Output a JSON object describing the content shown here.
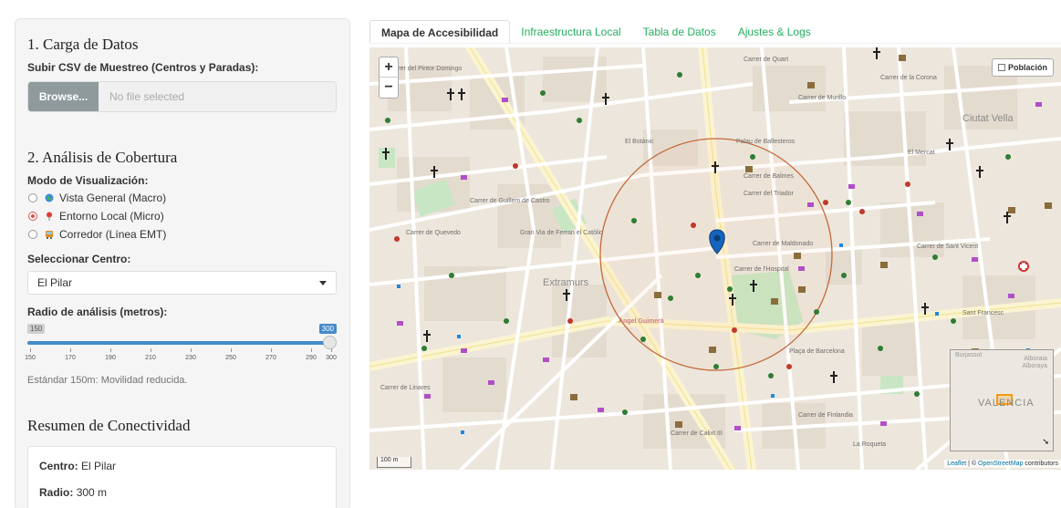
{
  "sidebar": {
    "section1_title": "1. Carga de Datos",
    "upload_label": "Subir CSV de Muestreo (Centros y Paradas):",
    "browse_label": "Browse...",
    "file_placeholder": "No file selected",
    "section2_title": "2. Análisis de Cobertura",
    "mode_label": "Modo de Visualización:",
    "modes": [
      {
        "label": "Vista General (Macro)",
        "icon": "globe-icon",
        "selected": false
      },
      {
        "label": "Entorno Local (Micro)",
        "icon": "pin-icon",
        "selected": true
      },
      {
        "label": "Corredor (Línea EMT)",
        "icon": "bus-icon",
        "selected": false
      }
    ],
    "center_label": "Seleccionar Centro:",
    "center_value": "El Pilar",
    "radius_label": "Radio de análisis (metros):",
    "slider": {
      "min": 150,
      "max": 300,
      "value": 300,
      "min_label": "150",
      "max_label": "300",
      "ticks": [
        "150",
        "170",
        "190",
        "210",
        "230",
        "250",
        "270",
        "290",
        "300"
      ]
    },
    "help_text": "Estándar 150m: Movilidad reducida.",
    "summary_title": "Resumen de Conectividad",
    "summary": {
      "center_key": "Centro:",
      "center_value": "El Pilar",
      "radius_key": "Radio:",
      "radius_value": "300 m"
    }
  },
  "tabs": [
    {
      "label": "Mapa de Accesibilidad",
      "active": true
    },
    {
      "label": "Infraestructura Local",
      "active": false
    },
    {
      "label": "Tabla de Datos",
      "active": false
    },
    {
      "label": "Ajustes & Logs",
      "active": false
    }
  ],
  "map": {
    "zoom_in": "+",
    "zoom_out": "−",
    "layer_label": "Población",
    "scale_label": "100 m",
    "attribution_leaflet": "Leaflet",
    "attribution_sep": " | © ",
    "attribution_osm": "OpenStreetMap",
    "attribution_tail": " contributors",
    "minimap": {
      "city": "VALENCIA",
      "label_1": "Burjassot",
      "label_2": "Alboraia",
      "label_3": "Alboraya"
    },
    "labels": [
      "Carrer de Quart",
      "Carrer del Pintor Domingo",
      "Ciutat Vella",
      "El Botànic",
      "Extramurs",
      "Àngel Guimerà",
      "Carrer de Sant Vicent",
      "El Mercat",
      "Carrer de Guillem de Castro",
      "Carrer de la Corona",
      "Carrer de Murillo",
      "Carrer del Triador",
      "Carrer de Maldonado",
      "Carrer de l'Hospital",
      "Plaça de Barcelona",
      "Carrer de Calixt III",
      "Gran Via de Ferran el Catòlic",
      "Sant Francesc",
      "La Roqueta",
      "Carrer de Linares",
      "Carrer de Balmes",
      "Palau de Ballesteros",
      "Carrer de Quevedo",
      "Carrer de Finlandia"
    ],
    "colors": {
      "accent": "#27ae60",
      "circle": "#c26a3a",
      "slider": "#428bca",
      "radio": "#d9534f"
    }
  }
}
